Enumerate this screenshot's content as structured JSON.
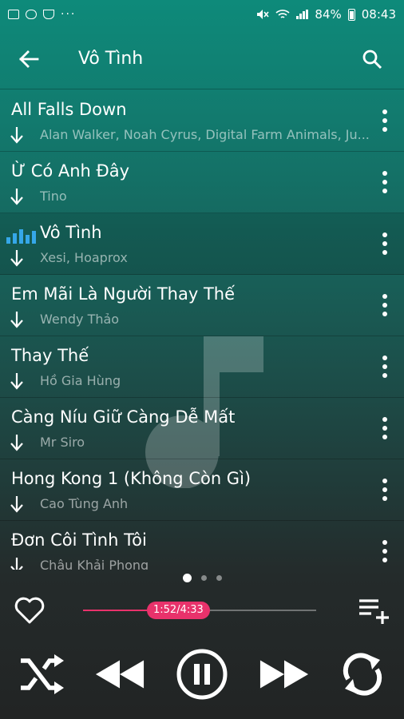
{
  "status_bar": {
    "battery": "84%",
    "time": "08:43",
    "more_indicator": "···",
    "icons": [
      "gallery-icon",
      "cloud-icon",
      "boat-icon",
      "mute-icon",
      "wifi-icon",
      "signal-icon",
      "battery-icon"
    ]
  },
  "app_bar": {
    "title": "Vô Tình",
    "back_icon": "arrow-left-icon",
    "search_icon": "search-icon"
  },
  "songs": [
    {
      "title": "All Falls Down",
      "artist": "Alan Walker, Noah Cyrus, Digital Farm Animals, Ju...",
      "playing": false
    },
    {
      "title": "Ừ Có Anh Đây",
      "artist": "Tino",
      "playing": false
    },
    {
      "title": "Vô Tình",
      "artist": "Xesi, Hoaprox",
      "playing": true
    },
    {
      "title": "Em Mãi Là Người Thay Thế",
      "artist": "Wendy Thảo",
      "playing": false
    },
    {
      "title": "Thay Thế",
      "artist": "Hồ Gia Hùng",
      "playing": false
    },
    {
      "title": "Càng Níu Giữ Càng Dễ Mất",
      "artist": "Mr Siro",
      "playing": false
    },
    {
      "title": "Hong Kong 1 (Không Còn Gì)",
      "artist": "Cao Tùng Anh",
      "playing": false
    },
    {
      "title": "Đơn Côi Tình Tôi",
      "artist": "Châu Khải Phong",
      "playing": false
    }
  ],
  "pager": {
    "pages": 3,
    "active": 0
  },
  "player": {
    "position": "1:52",
    "duration": "4:33",
    "time_display": "1:52/4:33",
    "progress": 0.41,
    "accent_color": "#e8326b",
    "playing_indicator_color": "#35a7e8"
  },
  "controls": {
    "favorite_icon": "heart-outline-icon",
    "queue_icon": "playlist-add-icon",
    "shuffle_icon": "shuffle-icon",
    "previous_icon": "rewind-icon",
    "pause_icon": "pause-icon",
    "next_icon": "fast-forward-icon",
    "repeat_icon": "repeat-icon"
  }
}
